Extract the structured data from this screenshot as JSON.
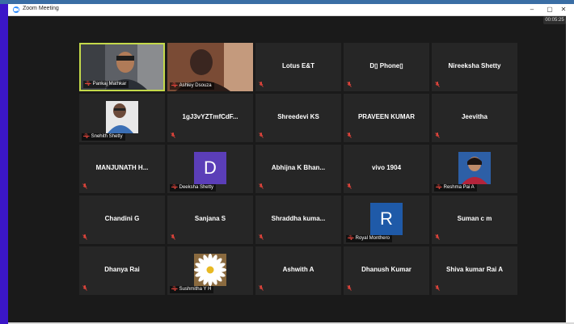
{
  "window": {
    "title": "Zoom Meeting",
    "minimize_glyph": "–",
    "maximize_glyph": "▢",
    "close_glyph": "✕"
  },
  "meeting": {
    "timer": "00:05:25"
  },
  "colors": {
    "stage": "#1a1a1a",
    "tile": "#262626",
    "active_speaker_border": "#c4d94a",
    "muted_mic": "#e0443b",
    "avatar_d": "#5b3eb8",
    "avatar_r": "#1f5aa8"
  },
  "participants": [
    {
      "name": "Pankaj Mathkar",
      "kind": "video",
      "label": "Pankaj Mathkar",
      "active": true
    },
    {
      "name": "Ashley Dsouza",
      "kind": "video",
      "label": "Ashley Dsouza"
    },
    {
      "name": "Lotus E&T",
      "kind": "name"
    },
    {
      "name": "D▯ Phone▯",
      "kind": "name"
    },
    {
      "name": "Nireeksha Shetty",
      "kind": "name"
    },
    {
      "name": "Snehith Shetty",
      "kind": "photo",
      "label": "Snehith Shetty"
    },
    {
      "name": "1gJ3vYZTmfCdF...",
      "kind": "name"
    },
    {
      "name": "Shreedevi KS",
      "kind": "name"
    },
    {
      "name": "PRAVEEN KUMAR",
      "kind": "name"
    },
    {
      "name": "Jeevitha",
      "kind": "name"
    },
    {
      "name": "MANJUNATH H...",
      "kind": "name"
    },
    {
      "name": "Deeksha Shetty",
      "kind": "avatar",
      "initial": "D",
      "label": "Deeksha Shetty"
    },
    {
      "name": "Abhijna K Bhan...",
      "kind": "name"
    },
    {
      "name": "vivo 1904",
      "kind": "name"
    },
    {
      "name": "Reshma Pai A",
      "kind": "photo",
      "label": "Reshma Pai A"
    },
    {
      "name": "Chandini G",
      "kind": "name"
    },
    {
      "name": "Sanjana S",
      "kind": "name"
    },
    {
      "name": "Shraddha  kuma...",
      "kind": "name"
    },
    {
      "name": "Royal Monthero",
      "kind": "avatar",
      "initial": "R",
      "label": "Royal Monthero"
    },
    {
      "name": "Suman c m",
      "kind": "name"
    },
    {
      "name": "Dhanya Rai",
      "kind": "name"
    },
    {
      "name": "Sushmitha Y H",
      "kind": "photo",
      "label": "Sushmitha Y H"
    },
    {
      "name": "Ashwith A",
      "kind": "name"
    },
    {
      "name": "Dhanush Kumar",
      "kind": "name"
    },
    {
      "name": "Shiva kumar Rai A",
      "kind": "name"
    }
  ]
}
